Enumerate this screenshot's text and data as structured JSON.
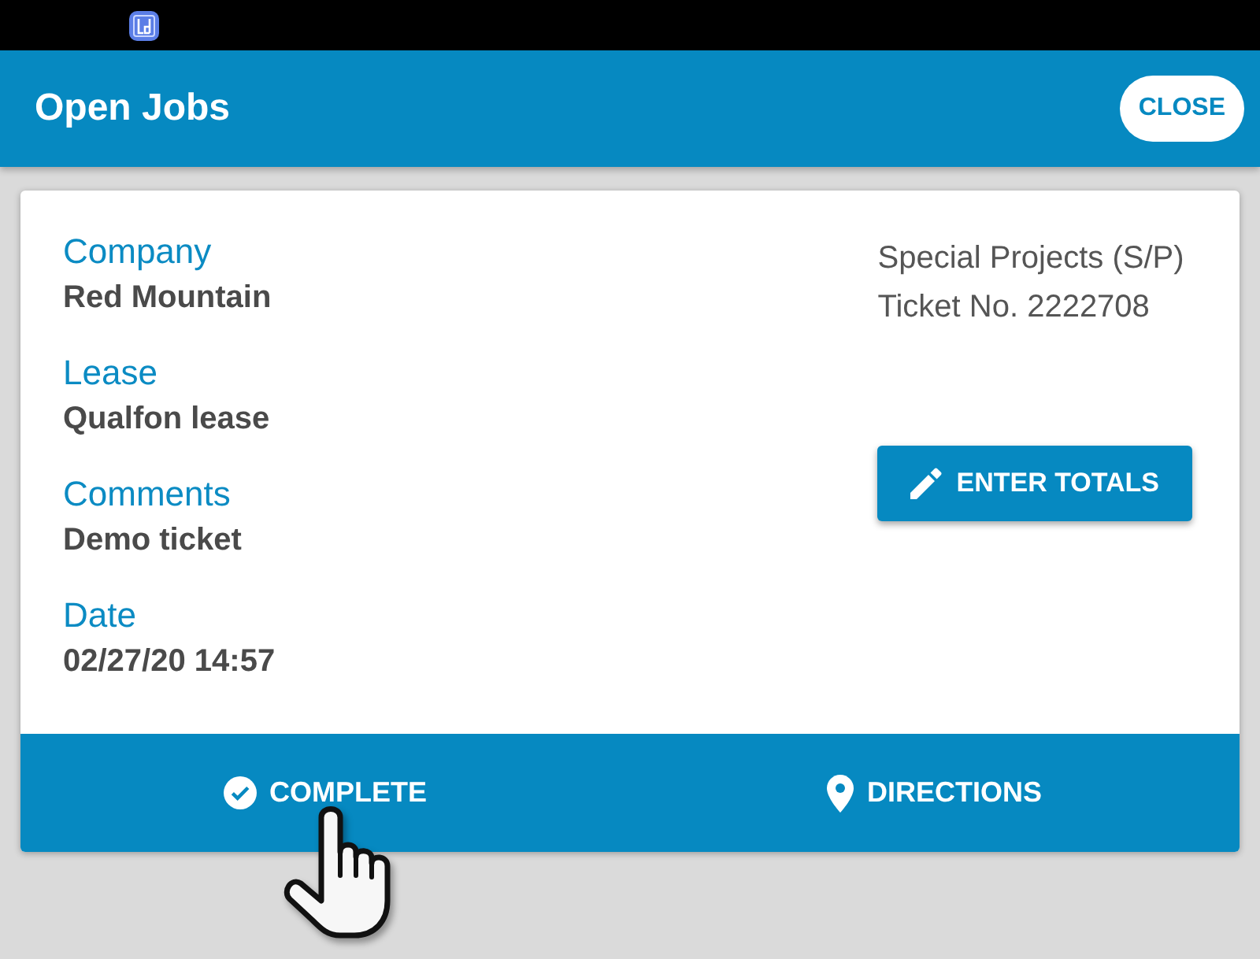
{
  "app_bar": {
    "title": "Open Jobs",
    "close_button": "CLOSE"
  },
  "job": {
    "fields": [
      {
        "label": "Company",
        "value": "Red Mountain"
      },
      {
        "label": "Lease",
        "value": "Qualfon lease"
      },
      {
        "label": "Comments",
        "value": "Demo ticket"
      },
      {
        "label": "Date",
        "value": "02/27/20 14:57"
      }
    ],
    "category": "Special Projects (S/P)",
    "ticket": "Ticket No. 2222708",
    "enter_totals_button": "ENTER TOTALS"
  },
  "actions": [
    {
      "kind": "complete",
      "label": "COMPLETE"
    },
    {
      "kind": "directions",
      "label": "DIRECTIONS"
    }
  ]
}
